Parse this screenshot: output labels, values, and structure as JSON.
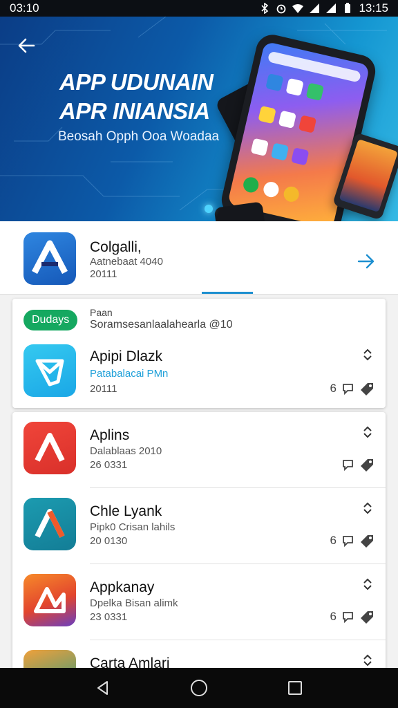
{
  "status_bar": {
    "time_left": "03:10",
    "time_right": "13:15"
  },
  "hero": {
    "title_line1": "APP UDUNAIN",
    "title_line2": "APR INIANSIA",
    "subtitle": "Beosah Opph Ooa Woadaa"
  },
  "featured": {
    "name": "Colgalli,",
    "meta1": "Aatnebaat 4040",
    "meta2": "20111",
    "icon": "a-logo-icon",
    "accent": "#1d8fd0"
  },
  "section": {
    "badge": "Dudays",
    "label": "Paan",
    "desc": "Soramsesanlaalahearla @10"
  },
  "apps": [
    {
      "name": "Apipi Dlazk",
      "meta1": "Patabalacai PMn",
      "meta2": "20111",
      "count": "6",
      "highlight": true
    },
    {
      "name": "Aplins",
      "meta1": "Dalablaas 2010",
      "meta2": "26 0331",
      "count": ""
    },
    {
      "name": "Chle Lyank",
      "meta1": "Pipk0 Crisan lahils",
      "meta2": "20 0130",
      "count": "6"
    },
    {
      "name": "Appkanay",
      "meta1": "Dpelka Bisan alimk",
      "meta2": "23 0331",
      "count": "6"
    },
    {
      "name": "Carta Amlari",
      "meta1": "",
      "meta2": "",
      "count": ""
    }
  ],
  "colors": {
    "badge": "#15a860",
    "link": "#1d8fd0"
  }
}
